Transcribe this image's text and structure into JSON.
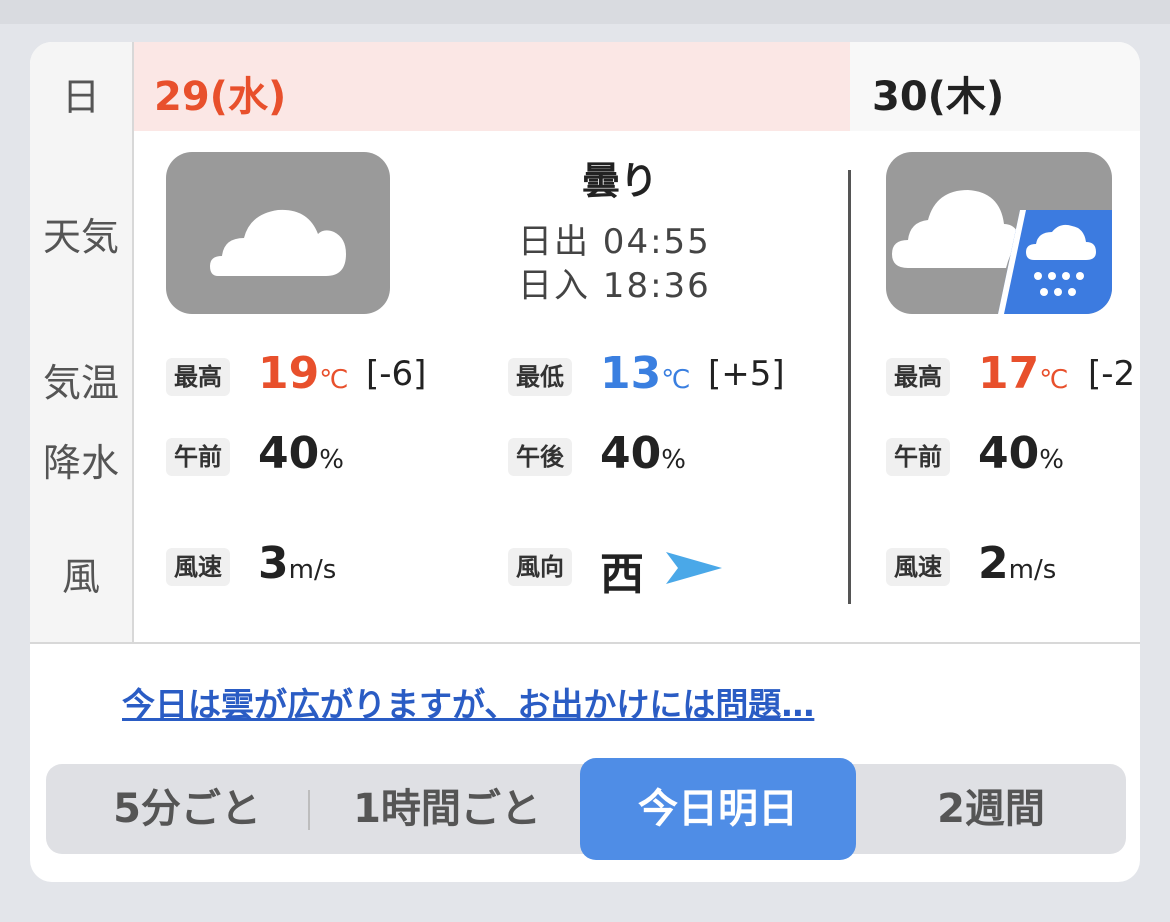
{
  "row_labels": {
    "date": "日",
    "weather": "天気",
    "temperature": "気温",
    "precipitation": "降水",
    "wind": "風"
  },
  "day1": {
    "date": "29(水)",
    "weather": "曇り",
    "sunrise": "日出 04:55",
    "sunset": "日入 18:36",
    "max_label": "最高",
    "max_value": "19",
    "max_unit": "℃",
    "max_diff": "[-6]",
    "min_label": "最低",
    "min_value": "13",
    "min_unit": "℃",
    "min_diff": "[+5]",
    "am_label": "午前",
    "am_value": "40",
    "pm_label": "午後",
    "pm_value": "40",
    "percent_unit": "%",
    "wind_speed_label": "風速",
    "wind_speed_value": "3",
    "wind_unit": "m/s",
    "wind_dir_label": "風向",
    "wind_dir_value": "西"
  },
  "day2": {
    "date": "30(木)",
    "max_label": "最高",
    "max_value": "17",
    "max_unit": "℃",
    "max_diff": "[-2",
    "am_label": "午前",
    "am_value": "40",
    "percent_unit": "%",
    "wind_speed_label": "風速",
    "wind_speed_value": "2",
    "wind_unit": "m/s"
  },
  "comment": "今日は雲が広がりますが、お出かけには問題…",
  "tabs": {
    "five_min": "5分ごと",
    "hourly": "1時間ごと",
    "today_tomorrow": "今日明日",
    "two_weeks": "2週間"
  },
  "colors": {
    "high_temp": "#e8502c",
    "low_temp": "#3a7fe0",
    "active_tab": "#4f8de6",
    "link": "#2a5cc4",
    "icons": [
      "cloud-icon",
      "cloud-then-rain-icon",
      "wind-direction-arrow-icon"
    ]
  }
}
